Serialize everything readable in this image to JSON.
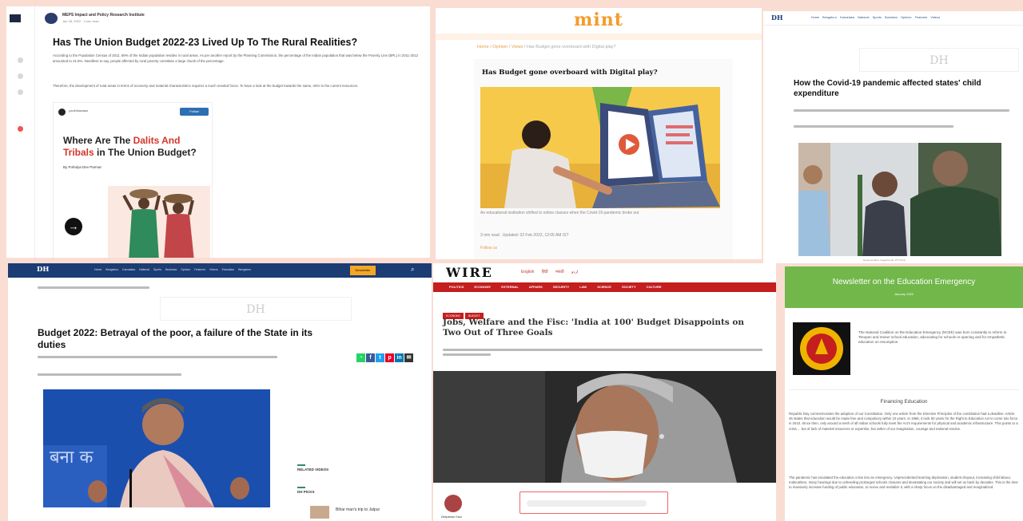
{
  "p1": {
    "author_name": "MEPS Impact and Policy Research Institute",
    "author_date": "Jan 28, 2022 · 4 min read",
    "title": "Has The Union Budget 2022-23 Lived Up To The Rural Realities?",
    "para1": "According to the Population Census of 2011, 69% of the Indian population resides in rural areas. As per another report by the Planning Commission, the percentage of the Indian population that was below the Poverty Line (BPL) in 2011-2012 amounted to 21.9%. Needless to say, people affected by rural poverty constitute a large chunk of the percentage.",
    "para2": "Therefore, the development of rural areas in terms of economy and material characteristics requires a much needed focus. To have a look at the budget towards the same, refer to the current resources.",
    "card_channel": "youthkiawaaz",
    "card_button": "Follow",
    "card_title_1": "Where Are The ",
    "card_title_hl1": "Dalits And",
    "card_title_hl2": "Tribals",
    "card_title_2": " in The Union Budget?",
    "card_byline": "By Pohulya Dev Parmar",
    "card_arrow": "→"
  },
  "p2": {
    "logo": "mint",
    "crumb_home": "Home",
    "crumb_opinion": "Opinion",
    "crumb_views": "Views",
    "crumb_current": "Has Budget gone overboard with Digital play?",
    "title": "Has Budget gone overboard with Digital play?",
    "caption": "An educational institution shifted to online classes when the Covid-19 pandemic broke out",
    "meta": "3 min read . Updated: 02 Feb 2022, 12:05 AM IST",
    "follow": "Follow us"
  },
  "p3": {
    "brand": "DH",
    "nav": "Home Bengaluru Karnataka National Sports Business Opinion Features Videos",
    "masthead": "DH",
    "title": "How the Covid-19 pandemic affected states' child expenditure",
    "photo_caption": "Representative Image/Credit: PTI Photo"
  },
  "p4": {
    "brand": "DH",
    "nav": "Home Bengaluru Karnataka National Sports Business Opinion Features Videos Education Bengaluru",
    "newsletter": "Newsletter",
    "masthead": "DH",
    "title": "Budget 2022: Betrayal of the poor, a failure of the State in its duties",
    "related": "RELATED VIDEOS",
    "dh_picks": "DH PICKS",
    "pick_title": "Bihar man's trip to Jalpur"
  },
  "p5": {
    "logo": "WIRE",
    "langs": "English हिंदी मराठी اردو",
    "nav": "POLITICS ECONOMY EXTERNAL AFFAIRS SECURITY LAW SCIENCE SOCIETY CULTURE",
    "tag1": "ECONOMY",
    "tag2": "BUDGET",
    "title": "Jobs, Welfare and the Fisc: 'India at 100' Budget Disappoints on Two Out of Three Goals",
    "author": "Deepankar Gaur"
  },
  "p6": {
    "banner_title": "Newsletter on the Education Emergency",
    "banner_sub": "January 2022",
    "desc": "The National Coalition on the Education Emergency (NCEE) was born constantly to reform to 'Reopen and renew' school education, advocating for schools re-opening and for empathetic education on resumption.",
    "section": "Financing Education",
    "body1": "Republic Day commemorates the adoption of our Constitution. Only one article from the Directive Principles of the constitution had a deadline. Article 45 states that education would be made free and compulsory within 10 years. In 1968, it took 50 years for the Right to Education Act to come into force in 2010. Since then, only around a tenth of all Indian schools fully meet the Act's requirements for physical and academic infrastructure. This points to a crisis ... but of lack of material resources or expertise, but rather of our imagination, courage and national resolve.",
    "body2": "The pandemic has escalated the education crisis into an emergency. Unprecedented learning deprivation, student dropout, increasing child labour, malnutrition, many hearings due to unheeding prolonged schools closures and devastating our society and will set us back by decades. This is the time to massively increase funding of public education, to revive and revitalize it, with a sharp focus on the disadvantaged and marginalized."
  },
  "colors": {
    "page_bg": "#f9ddd3",
    "mint_orange": "#f39c2b",
    "dh_blue": "#1c3c74",
    "wire_red": "#c41e1e",
    "ncee_green": "#71b74a"
  }
}
